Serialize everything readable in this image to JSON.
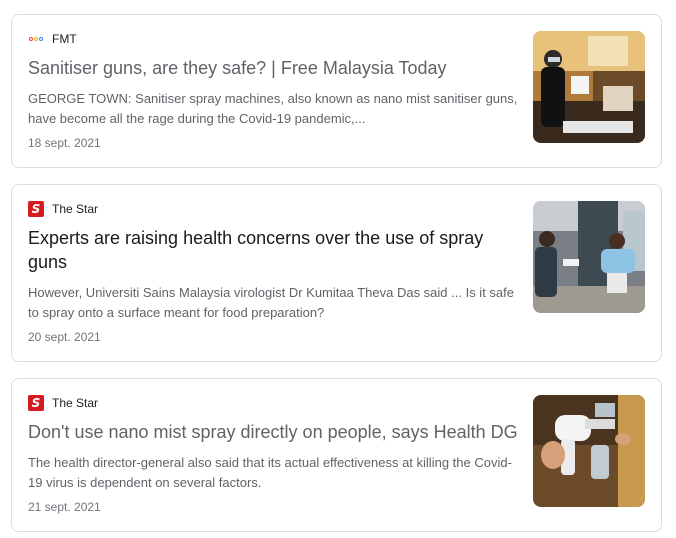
{
  "articles": [
    {
      "source": "FMT",
      "source_icon": "fmt-logo-icon",
      "title": "Sanitiser guns, are they safe? | Free Malaysia Today",
      "snippet": "GEORGE TOWN: Sanitiser spray machines, also known as nano mist sanitiser guns, have become all the rage during the Covid-19 pandemic,...",
      "date": "18 sept. 2021",
      "thumbnail": "thumbnail-sanitiser-station"
    },
    {
      "source": "The Star",
      "source_icon": "the-star-logo-icon",
      "title": "Experts are raising health concerns over the use of spray guns",
      "snippet": "However, Universiti Sains Malaysia virologist Dr Kumitaa Theva Das said ... Is it safe to spray onto a surface meant for food preparation?",
      "date": "20 sept. 2021",
      "thumbnail": "thumbnail-shop-spraying"
    },
    {
      "source": "The Star",
      "source_icon": "the-star-logo-icon",
      "title": "Don't use nano mist spray directly on people, says Health DG",
      "snippet": "The health director-general also said that its actual effectiveness at killing the Covid-19 virus is dependent on several factors.",
      "date": "21 sept. 2021",
      "thumbnail": "thumbnail-spray-gun"
    }
  ],
  "colors": {
    "star_red": "#d71920",
    "visited_title": "#5f6368",
    "title": "#1a1a1a",
    "snippet": "#5f6368",
    "border": "#dadce0"
  }
}
